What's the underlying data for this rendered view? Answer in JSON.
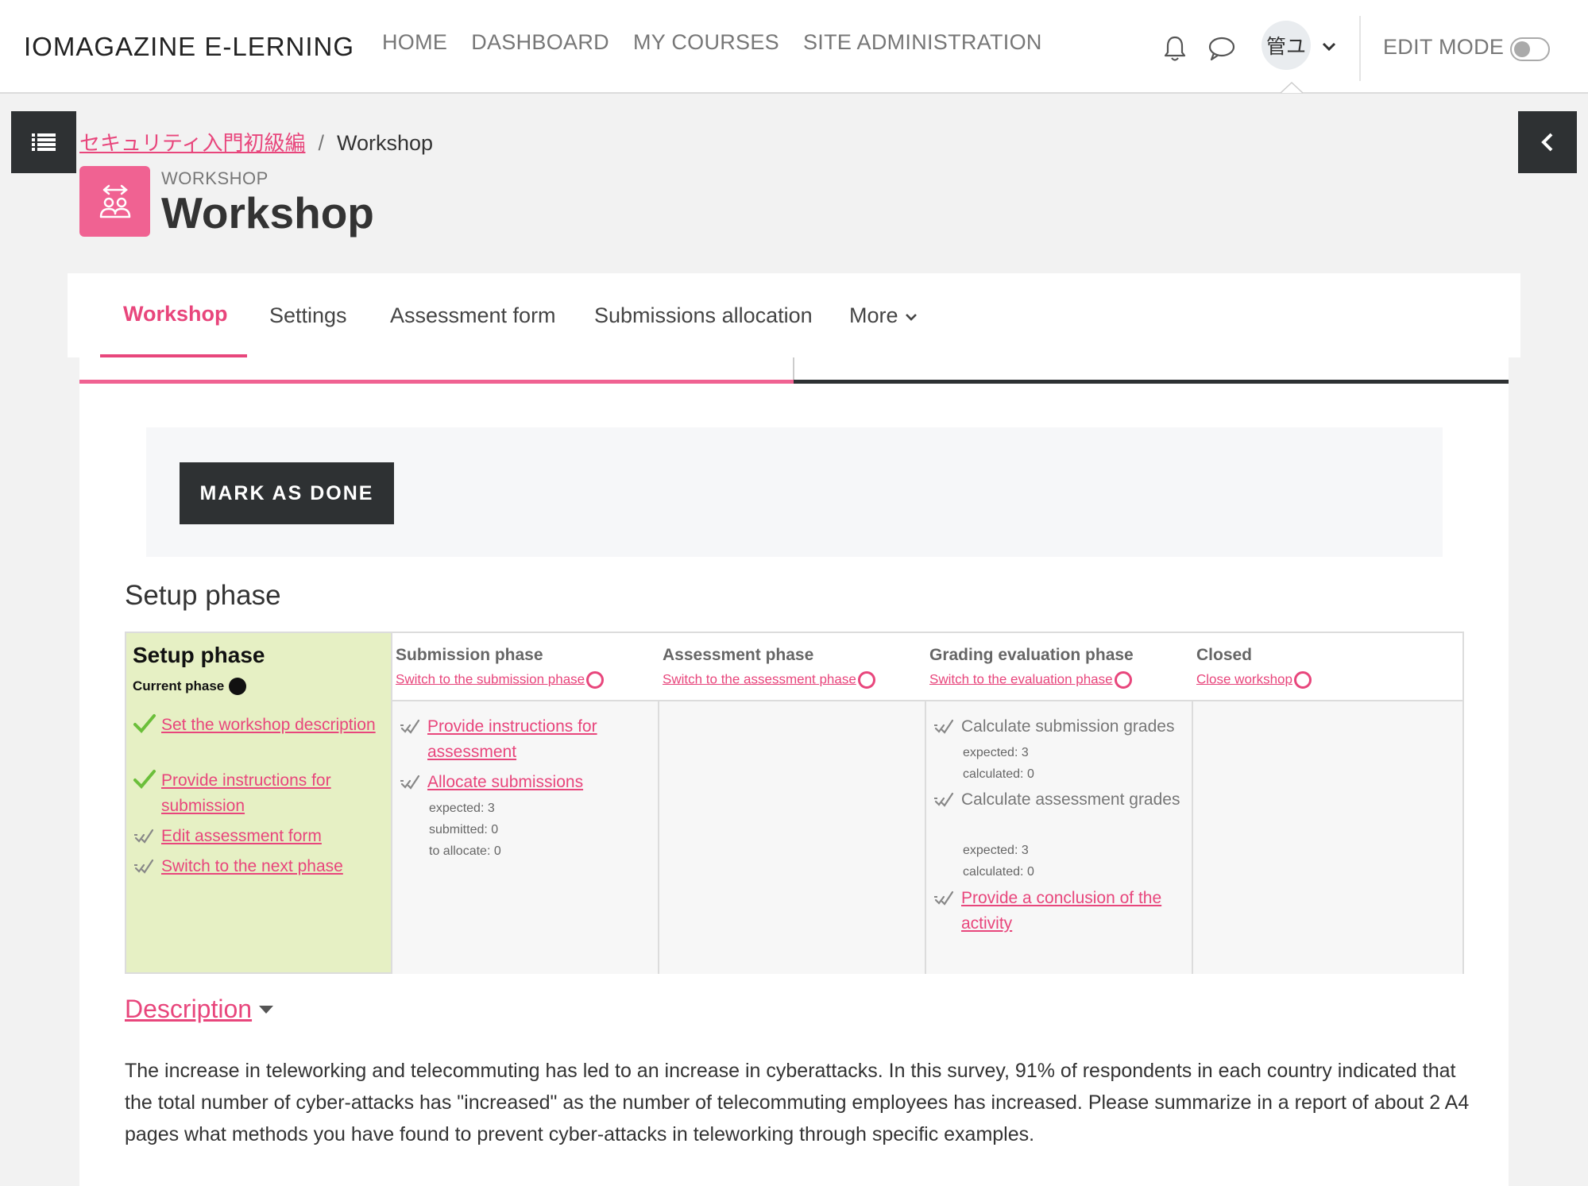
{
  "navbar": {
    "brand": "IOMAGAZINE E-LERNING",
    "links": [
      "HOME",
      "DASHBOARD",
      "MY COURSES",
      "SITE ADMINISTRATION"
    ],
    "avatar_initials": "管ユ",
    "edit_mode_label": "EDIT MODE"
  },
  "breadcrumb": {
    "course": "セキュリティ入門初級編",
    "separator": "/",
    "current": "Workshop"
  },
  "header": {
    "pretitle": "WORKSHOP",
    "title": "Workshop"
  },
  "secondary_nav": {
    "tabs": [
      "Workshop",
      "Settings",
      "Assessment form",
      "Submissions allocation",
      "More"
    ]
  },
  "completion": {
    "button_label": "MARK AS DONE"
  },
  "phase_heading": "Setup phase",
  "phases": {
    "setup": {
      "title": "Setup phase",
      "current_label": "Current phase",
      "tasks": [
        "Set the workshop description",
        "Provide instructions for submission",
        "Edit assessment form",
        "Switch to the next phase"
      ]
    },
    "submission": {
      "title": "Submission phase",
      "switch": "Switch to the submission phase",
      "tasks": [
        "Provide instructions for assessment",
        "Allocate submissions"
      ],
      "info": [
        "expected: 3",
        "submitted: 0",
        "to allocate: 0"
      ]
    },
    "assessment": {
      "title": "Assessment phase",
      "switch": "Switch to the assessment phase"
    },
    "grading": {
      "title": "Grading evaluation phase",
      "switch": "Switch to the evaluation phase",
      "tasks": [
        "Calculate submission grades",
        "Calculate assessment grades",
        "Provide a conclusion of the activity"
      ],
      "info1": [
        "expected: 3",
        "calculated: 0"
      ],
      "info2": [
        "expected: 3",
        "calculated: 0"
      ]
    },
    "closed": {
      "title": "Closed",
      "switch": "Close workshop"
    }
  },
  "description": {
    "label": "Description",
    "text": "The increase in teleworking and telecommuting has led to an increase in cyberattacks. In this survey, 91% of respondents in each country indicated that the total number of cyber-attacks has \"increased\" as the number of telecommuting employees has increased. Please summarize in a report of about 2 A4 pages what methods you have found to prevent cyber-attacks in teleworking through specific examples."
  },
  "colors": {
    "accent": "#e8467c",
    "dark": "#2e3133",
    "setup_bg": "#e6f0c4",
    "check_green": "#6bbf3a"
  }
}
